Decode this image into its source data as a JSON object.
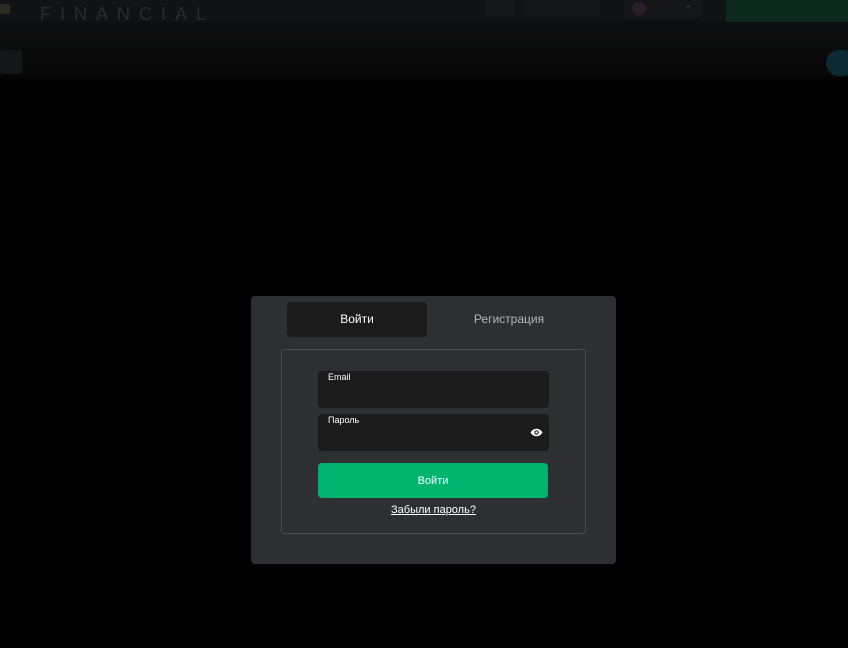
{
  "header": {
    "logo_text": "FINANCIAL",
    "top_pill_text": "",
    "language": "",
    "cta_text": "",
    "right_link_text": ""
  },
  "modal": {
    "tabs": [
      {
        "label": "Войти",
        "active": true
      },
      {
        "label": "Регистрация",
        "active": false
      }
    ],
    "email": {
      "label": "Email",
      "value": "",
      "placeholder": ""
    },
    "password": {
      "label": "Пароль",
      "value": "",
      "placeholder": ""
    },
    "submit_label": "Войти",
    "forgot_label": "Забыли пароль?"
  },
  "colors": {
    "accent": "#00b46e",
    "modal_bg": "#2e2f33",
    "field_bg": "#1b1b1c"
  },
  "icons": {
    "password_toggle": "eye-icon"
  }
}
